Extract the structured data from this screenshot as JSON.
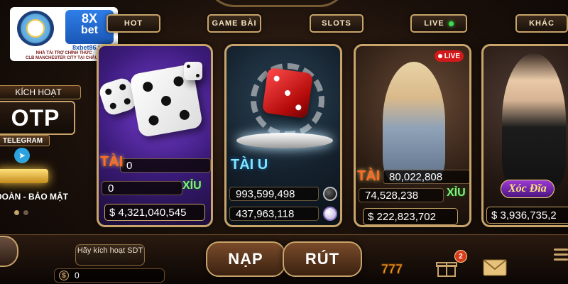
{
  "tabs": [
    {
      "label": "HOT"
    },
    {
      "label": "GAME BÀI"
    },
    {
      "label": "SLOTS"
    },
    {
      "label": "LIVE"
    },
    {
      "label": "KHÁC"
    }
  ],
  "sponsor": {
    "brand_top": "8X",
    "brand_bottom": "bet",
    "url": "8xbet86.info",
    "line1": "NHÀ TÀI TRỢ CHÍNH THỨC",
    "line2": "CLB MANCHESTER CITY TẠI CHÂU Á"
  },
  "promo": {
    "activate_label": "KÍCH HOẠT",
    "otp": "OTP",
    "telegram": "TELEGRAM",
    "security": "ĐOÀN - BẢO MẬT"
  },
  "cards": [
    {
      "name": "tai-xiu-classic",
      "tai_label": "TÀI",
      "tai_value": "0",
      "xiu_value": "0",
      "xiu_label": "XỈU",
      "jackpot": "$ 4,321,040,545"
    },
    {
      "name": "tai-xiu-md5",
      "title": "TÀI U",
      "row1": "993,599,498",
      "row2": "437,963,118"
    },
    {
      "name": "live-tai-xiu",
      "live": "LIVE",
      "tai_label": "TÀI",
      "tai_value": "80,022,808",
      "xiu_value": "74,528,238",
      "xiu_label": "XỈU",
      "jackpot": "$ 222,823,702"
    },
    {
      "name": "xoc-dia",
      "title": "Xóc Đĩa",
      "jackpot": "$ 3,936,735,2"
    }
  ],
  "bottom": {
    "activate_sdt": "Hãy kích hoạt SDT",
    "balance": "0",
    "coin_symbol": "$",
    "deposit": "NẠP",
    "withdraw": "RÚT",
    "notification_count": "2"
  },
  "colors": {
    "gold": "#c8a46a",
    "live_red": "#d31919",
    "tai_orange": "#ff6b2a",
    "xiu_green": "#7ff27a"
  }
}
